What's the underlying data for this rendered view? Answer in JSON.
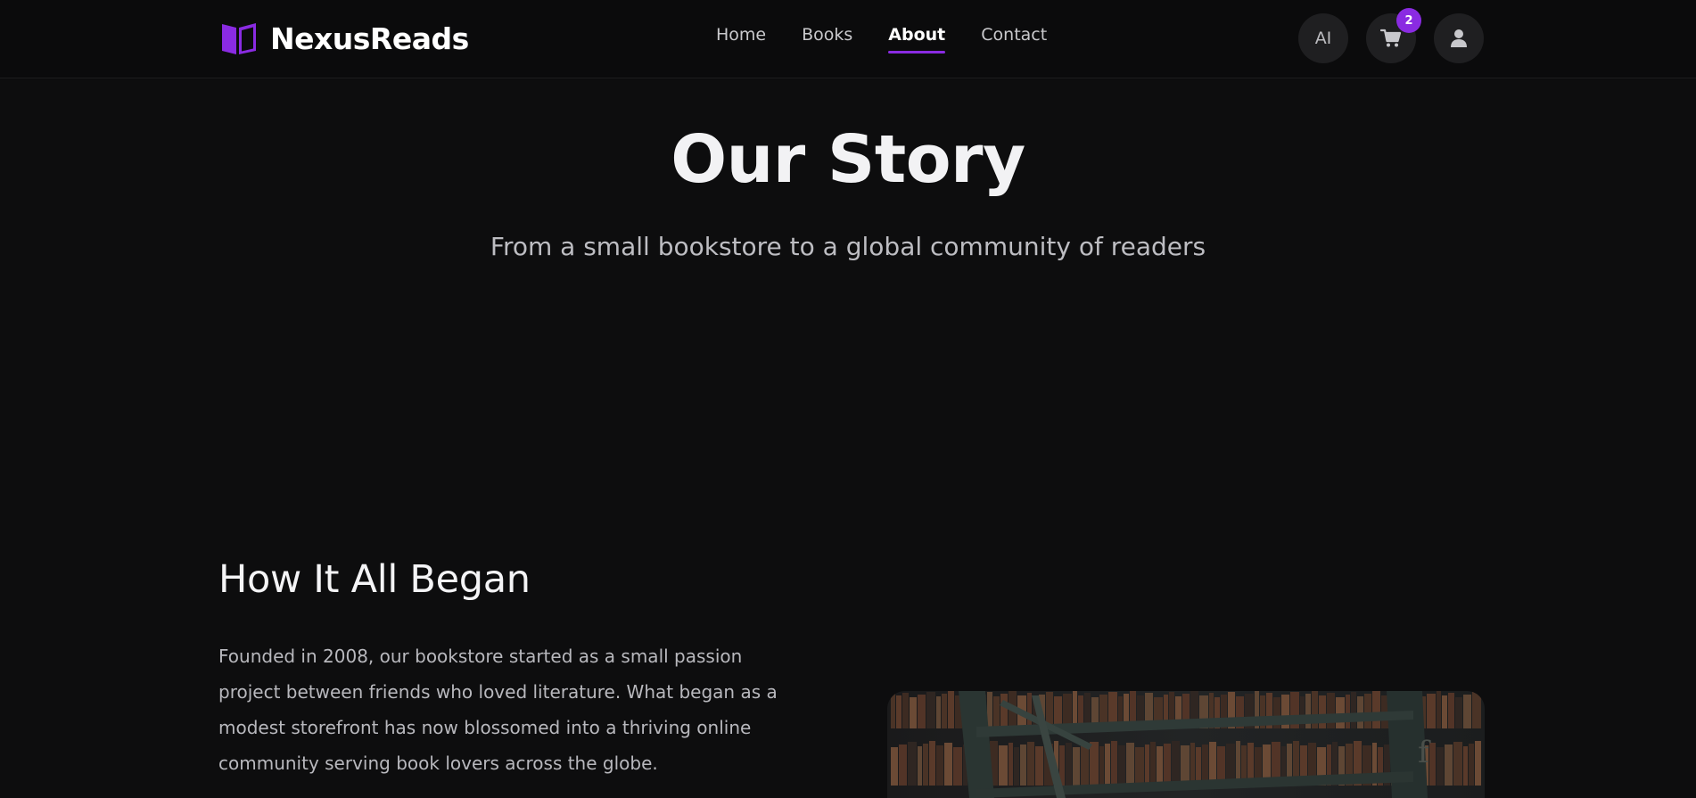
{
  "brand": {
    "name": "NexusReads",
    "logo_icon": "open-book-icon",
    "accent": "#8a2be2"
  },
  "nav": {
    "links": [
      {
        "label": "Home",
        "active": false
      },
      {
        "label": "Books",
        "active": false
      },
      {
        "label": "About",
        "active": true
      },
      {
        "label": "Contact",
        "active": false
      }
    ]
  },
  "actions": {
    "ai_label": "AI",
    "cart_icon": "cart-icon",
    "cart_count": "2",
    "profile_icon": "user-icon"
  },
  "hero": {
    "title": "Our Story",
    "subtitle": "From a small bookstore to a global community of readers"
  },
  "story": {
    "heading": "How It All Began",
    "paragraph": "Founded in 2008, our bookstore started as a small passion project between friends who loved literature. What began as a modest storefront has now blossomed into a thriving online community serving book lovers across the globe.",
    "image_subject": "library-bookshelves-photo"
  },
  "colors": {
    "background": "#0d0d0e",
    "navbar": "#0b0b0c",
    "accent": "#8a2be2",
    "button_bg": "#1f1f21"
  }
}
